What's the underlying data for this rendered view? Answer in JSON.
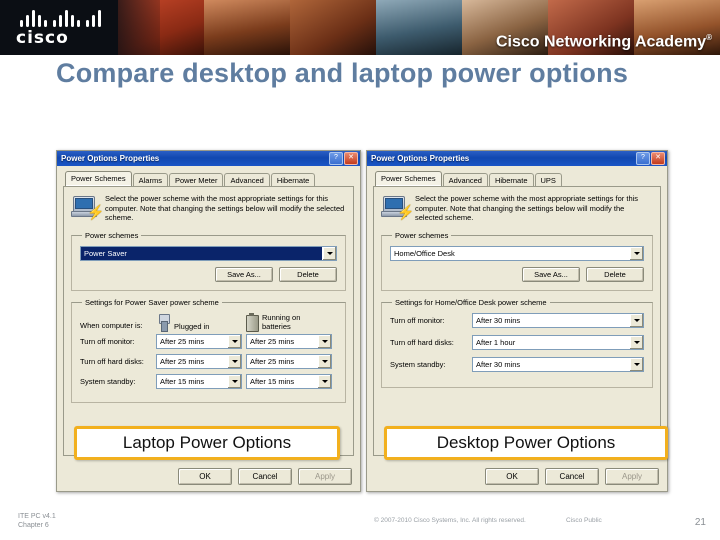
{
  "header": {
    "brand": "cisco",
    "academy_title": "Cisco Networking Academy",
    "trademark": "®"
  },
  "slide": {
    "title": "Compare desktop and laptop power options"
  },
  "laptop_dialog": {
    "title": "Power Options Properties",
    "buttons": {
      "help": "?",
      "close": "✕"
    },
    "tabs": [
      {
        "label": "Power Schemes",
        "active": true
      },
      {
        "label": "Alarms",
        "active": false
      },
      {
        "label": "Power Meter",
        "active": false
      },
      {
        "label": "Advanced",
        "active": false
      },
      {
        "label": "Hibernate",
        "active": false
      }
    ],
    "info_text": "Select the power scheme with the most appropriate settings for this computer. Note that changing the settings below will modify the selected scheme.",
    "power_schemes_group": "Power schemes",
    "scheme_value": "Power Saver",
    "save_as_label": "Save As...",
    "delete_label": "Delete",
    "settings_group": "Settings for Power Saver power scheme",
    "when_computer_label": "When computer is:",
    "column_plugged": "Plugged in",
    "column_battery": "Running on batteries",
    "rows": [
      {
        "label": "Turn off monitor:",
        "plugged": "After 25 mins",
        "battery": "After 25 mins"
      },
      {
        "label": "Turn off hard disks:",
        "plugged": "After 25 mins",
        "battery": "After 25 mins"
      },
      {
        "label": "System standby:",
        "plugged": "After 15 mins",
        "battery": "After 15 mins"
      }
    ],
    "footer": {
      "ok": "OK",
      "cancel": "Cancel",
      "apply": "Apply"
    }
  },
  "desktop_dialog": {
    "title": "Power Options Properties",
    "buttons": {
      "help": "?",
      "close": "✕"
    },
    "tabs": [
      {
        "label": "Power Schemes",
        "active": true
      },
      {
        "label": "Advanced",
        "active": false
      },
      {
        "label": "Hibernate",
        "active": false
      },
      {
        "label": "UPS",
        "active": false
      }
    ],
    "info_text": "Select the power scheme with the most appropriate settings for this computer. Note that changing the settings below will modify the selected scheme.",
    "power_schemes_group": "Power schemes",
    "scheme_value": "Home/Office Desk",
    "save_as_label": "Save As...",
    "delete_label": "Delete",
    "settings_group": "Settings for Home/Office Desk power scheme",
    "rows": [
      {
        "label": "Turn off monitor:",
        "value": "After 30 mins"
      },
      {
        "label": "Turn off hard disks:",
        "value": "After 1 hour"
      },
      {
        "label": "System standby:",
        "value": "After 30 mins"
      }
    ],
    "footer": {
      "ok": "OK",
      "cancel": "Cancel",
      "apply": "Apply"
    }
  },
  "callouts": {
    "laptop": "Laptop Power Options",
    "desktop": "Desktop Power Options"
  },
  "footer": {
    "course": "ITE PC v4.1",
    "chapter": "Chapter 6",
    "copyright": "© 2007-2010 Cisco Systems, Inc. All rights reserved.",
    "confidentiality": "Cisco Public",
    "page": "21"
  },
  "colors": {
    "title": "#5f7da0",
    "callout_border": "#f2b01e",
    "titlebar": "#1148b0",
    "dialog_face": "#ece9d8"
  }
}
